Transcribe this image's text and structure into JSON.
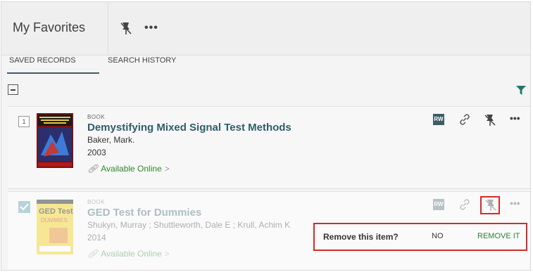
{
  "header": {
    "title": "My Favorites",
    "pin_icon": "unpin-icon",
    "more_label": "•••"
  },
  "tabs": [
    {
      "label": "SAVED RECORDS",
      "active": true
    },
    {
      "label": "SEARCH HISTORY",
      "active": false
    }
  ],
  "toolbar": {
    "collapse_icon": "collapse-all-icon",
    "filter_icon": "filter-icon"
  },
  "records": [
    {
      "index": "1",
      "type": "BOOK",
      "title": "Demystifying Mixed Signal Test Methods",
      "author": "Baker, Mark.",
      "year": "2003",
      "availability": "Available Online",
      "chevron": ">",
      "actions": {
        "rw": "RW",
        "link": "ℐ",
        "more": "•••"
      }
    },
    {
      "checked": true,
      "type": "BOOK",
      "title": "GED Test for Dummies",
      "author": "Shukyn, Murray ; Shuttleworth, Dale E ; Krull, Achim K",
      "year": "2014",
      "availability": "Available Online",
      "chevron": ">",
      "actions": {
        "rw": "RW",
        "link": "ℐ",
        "more": "•••"
      },
      "confirm": {
        "question": "Remove this item?",
        "no_label": "NO",
        "yes_label": "REMOVE IT"
      }
    }
  ],
  "colors": {
    "accent": "#2f5e6a",
    "available": "#2e8a2e",
    "highlight": "#d52a2a",
    "filter": "#1f7a6d"
  }
}
